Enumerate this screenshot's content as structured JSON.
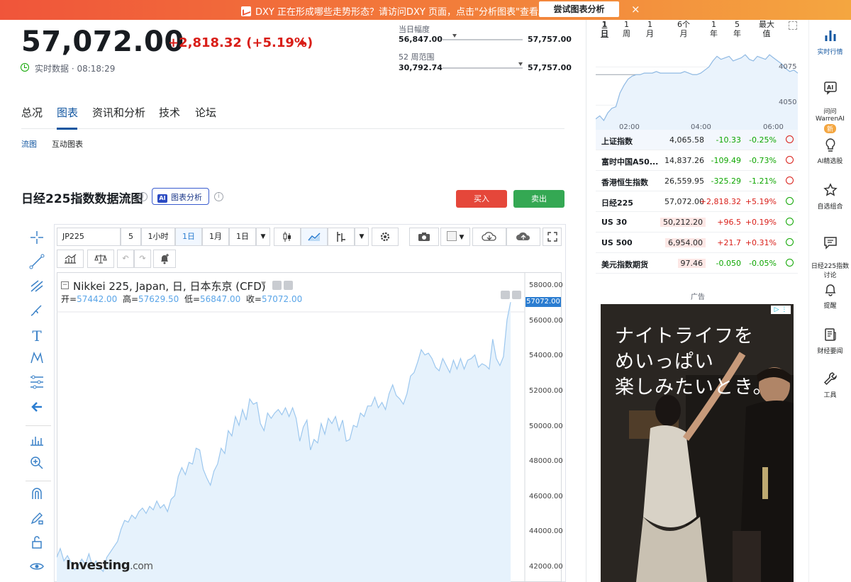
{
  "banner": {
    "message": "DXY 正在形成哪些走势形态？请访问DXY 页面，点击\"分析图表\"查看。",
    "cta": "尝试图表分析",
    "close": "×"
  },
  "quote": {
    "last": "57,072.00",
    "change": "+2,818.32",
    "change_pct": "(+5.19%)",
    "status": "实时数据 · 08:18:29",
    "day_range": {
      "label": "当日幅度",
      "low": "56,847.00",
      "high": "57,757.00",
      "position": 0.15
    },
    "week52_range": {
      "label": "52 周范围",
      "low": "30,792.74",
      "high": "57,757.00",
      "position": 0.97
    }
  },
  "tabs": [
    {
      "label": "总况"
    },
    {
      "label": "图表"
    },
    {
      "label": "资讯和分析"
    },
    {
      "label": "技术"
    },
    {
      "label": "论坛"
    }
  ],
  "subtabs": [
    {
      "label": "流图"
    },
    {
      "label": "互动图表"
    }
  ],
  "section": {
    "title": "日经225指数数据流图",
    "ai_button": "图表分析",
    "ai_tag": "AI",
    "buy": "买入",
    "sell": "卖出"
  },
  "chart_toolbar": {
    "symbol": "JP225",
    "intervals": [
      "5",
      "1小时",
      "1日",
      "1月",
      "1日"
    ],
    "active_interval": "1日"
  },
  "chart_legend": {
    "title": "Nikkei 225, Japan, 日, 日本东京 (CFD)",
    "open_label": "开=",
    "open": "57442.00",
    "high_label": "高=",
    "high": "57629.50",
    "low_label": "低=",
    "low": "56847.00",
    "close_label": "收=",
    "close": "57072.00"
  },
  "chart_data": {
    "type": "area",
    "title": "Nikkei 225, Japan, 日, 日本东京 (CFD)",
    "ylim": [
      41200,
      58800
    ],
    "yticks": [
      "58000.00",
      "56000.00",
      "54000.00",
      "52000.00",
      "50000.00",
      "48000.00",
      "46000.00",
      "44000.00",
      "42000.00"
    ],
    "last_price": "57072.00",
    "values": [
      42600,
      43100,
      42400,
      42700,
      42300,
      41900,
      42100,
      42500,
      42200,
      42800,
      42100,
      42400,
      42000,
      41800,
      42600,
      42900,
      43200,
      43500,
      44200,
      44700,
      44600,
      45000,
      44800,
      45200,
      45400,
      45100,
      45500,
      45300,
      45800,
      45400,
      45600,
      45200,
      45900,
      46100,
      47200,
      47700,
      47300,
      48000,
      47900,
      48800,
      48700,
      47600,
      47100,
      46700,
      47500,
      47900,
      48800,
      48500,
      49800,
      49500,
      50600,
      50100,
      51000,
      50400,
      51600,
      51300,
      51400,
      50200,
      49800,
      50800,
      50500,
      50800,
      51000,
      50700,
      51100,
      50600,
      51100,
      50500,
      49200,
      50000,
      50400,
      48700,
      49300,
      49100,
      50200,
      49600,
      50500,
      50200,
      50600,
      49800,
      50400,
      49200,
      49300,
      50100,
      50000,
      50800,
      50600,
      51200,
      51200,
      51700,
      51100,
      51400,
      51000,
      51900,
      52400,
      51800,
      51600,
      51300,
      51900,
      52900,
      53100,
      53700,
      54400,
      54100,
      54200,
      53900,
      53400,
      53200,
      53900,
      53500,
      53100,
      53800,
      53300,
      53900,
      53300,
      53800,
      53900,
      54100,
      53400,
      53600,
      53500,
      53300,
      55000,
      53900,
      53500,
      54000,
      56100,
      57100
    ]
  },
  "watermark": {
    "brand": "Investing",
    "suffix": ".com"
  },
  "mini_chart": {
    "periods": [
      "1\n日",
      "1\n周",
      "1\n月",
      "6个\n月",
      "1\n年",
      "5\n年",
      "最大\n值"
    ],
    "y_labels": [
      "4075",
      "4050"
    ],
    "x_labels": [
      "02:00",
      "04:00",
      "06:00"
    ],
    "values": [
      4041,
      4043,
      4040,
      4045,
      4048,
      4049,
      4058,
      4063,
      4067,
      4069,
      4070,
      4070,
      4071,
      4071,
      4071,
      4072,
      4071,
      4071,
      4071,
      4071,
      4071,
      4071,
      4072,
      4071,
      4070,
      4070,
      4071,
      4073,
      4075,
      4079,
      4082,
      4080,
      4081,
      4082,
      4079,
      4080,
      4081,
      4083,
      4080,
      4079,
      4082,
      4081,
      4080,
      4083,
      4081,
      4079,
      4077,
      4074,
      4072,
      4073,
      4071
    ]
  },
  "indices": [
    {
      "name": "上证指数",
      "last": "4,065.58",
      "change": "-10.33",
      "pct": "-0.25%",
      "status": "closed"
    },
    {
      "name": "富时中国A50...",
      "last": "14,837.26",
      "change": "-109.49",
      "pct": "-0.73%",
      "status": "closed"
    },
    {
      "name": "香港恒生指数",
      "last": "26,559.95",
      "change": "-325.29",
      "pct": "-1.21%",
      "status": "closed"
    },
    {
      "name": "日经225",
      "last": "57,072.00",
      "change": "+2,818.32",
      "pct": "+5.19%",
      "status": "open"
    },
    {
      "name": "US 30",
      "last": "50,212.20",
      "change": "+96.5",
      "pct": "+0.19%",
      "status": "open"
    },
    {
      "name": "US 500",
      "last": "6,954.00",
      "change": "+21.7",
      "pct": "+0.31%",
      "status": "open"
    },
    {
      "name": "美元指数期货",
      "last": "97.46",
      "change": "-0.050",
      "pct": "-0.05%",
      "status": "open"
    }
  ],
  "ad": {
    "label": "广告",
    "headline": "ナイトライフを\nめいっぱい\n楽しみたいとき。"
  },
  "rail": [
    {
      "label": "实时行情"
    },
    {
      "label": "问问\nWarrenAI"
    },
    {
      "label": "AI精选股"
    },
    {
      "label": "自选组合"
    },
    {
      "label": "日经225指数\n讨论"
    },
    {
      "label": "提醒"
    },
    {
      "label": "财经要闻"
    },
    {
      "label": "工具"
    }
  ],
  "rail_badge": "新",
  "colors": {
    "up": "#d91e18",
    "down": "#0ea600",
    "accent": "#1256a0",
    "chart_line": "#9cc7ee",
    "chart_fill": "#e6f2fc"
  }
}
